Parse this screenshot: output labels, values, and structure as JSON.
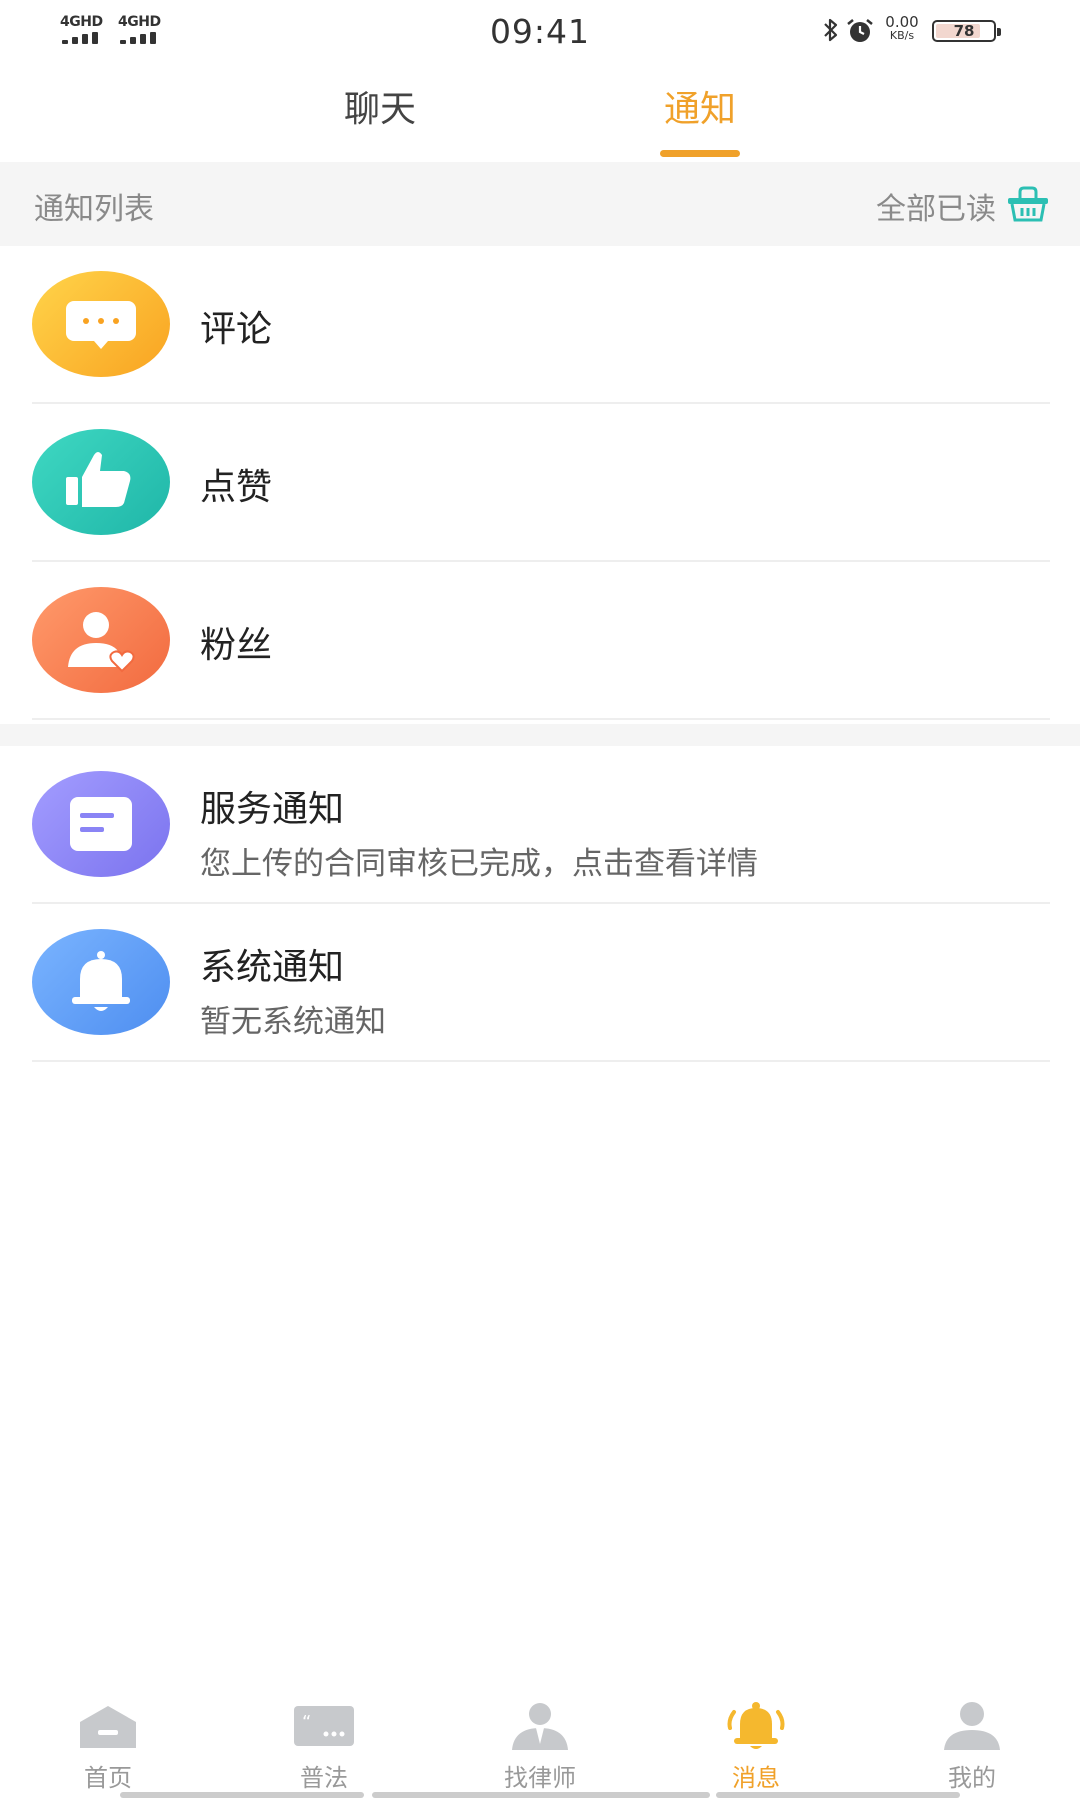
{
  "status_bar": {
    "net1": "4GHD",
    "net2": "4GHD",
    "time": "09:41",
    "net_speed_value": "0.00",
    "net_speed_unit": "KB/s",
    "battery_level": "78",
    "battery_fraction": 0.78,
    "icons": [
      "signal-icon",
      "bluetooth-icon",
      "alarm-icon",
      "battery-icon"
    ]
  },
  "tabs": [
    {
      "label": "聊天",
      "active": false
    },
    {
      "label": "通知",
      "active": true
    }
  ],
  "list_header": {
    "title": "通知列表",
    "mark_all_read": "全部已读",
    "mark_all_read_icon": "basket-icon"
  },
  "rows": [
    {
      "name": "评论",
      "desc": "",
      "icon": "comment-icon",
      "color": "#f9a321"
    },
    {
      "name": "点赞",
      "desc": "",
      "icon": "thumbs-up-icon",
      "color": "#1fb6a8"
    },
    {
      "name": "粉丝",
      "desc": "",
      "icon": "fans-icon",
      "color": "#f26a3f"
    },
    {
      "name": "服务通知",
      "desc": "您上传的合同审核已完成，点击查看详情",
      "icon": "message-icon",
      "color": "#7b73ee"
    },
    {
      "name": "系统通知",
      "desc": "暂无系统通知",
      "icon": "bell-icon",
      "color": "#4e8ef0"
    }
  ],
  "bottom_nav": [
    {
      "label": "首页",
      "icon": "home-icon",
      "active": false
    },
    {
      "label": "普法",
      "icon": "quote-icon",
      "active": false
    },
    {
      "label": "找律师",
      "icon": "lawyer-icon",
      "active": false
    },
    {
      "label": "消息",
      "icon": "bell-icon",
      "active": true
    },
    {
      "label": "我的",
      "icon": "profile-icon",
      "active": false
    }
  ],
  "colors": {
    "accent": "#f0a12a",
    "teal_icon": "#2bbfb3",
    "muted_text": "#8a8a8a",
    "nav_inactive": "#999999"
  }
}
